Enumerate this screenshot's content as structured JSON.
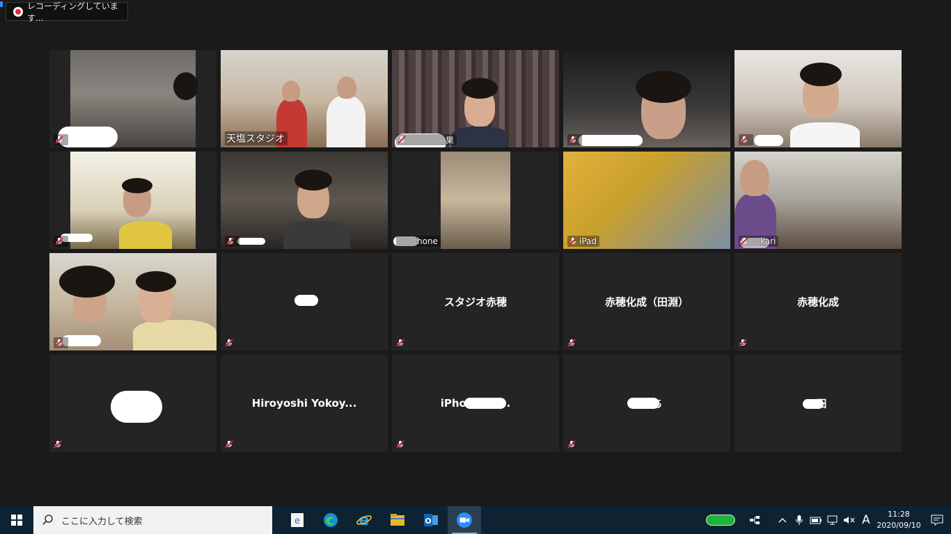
{
  "recording": {
    "label": "レコーディングしています..."
  },
  "tiles": [
    {
      "name": ""
    },
    {
      "name": "天塩スタジオ"
    },
    {
      "name": "果"
    },
    {
      "name": ""
    },
    {
      "name": ""
    },
    {
      "name": ""
    },
    {
      "name": ""
    },
    {
      "name": "hone"
    },
    {
      "name": "iPad"
    },
    {
      "name": "kari"
    },
    {
      "name": ""
    },
    {
      "name": ""
    },
    {
      "name": "スタジオ赤穂"
    },
    {
      "name": "赤穂化成（田淵）"
    },
    {
      "name": "赤穂化成"
    },
    {
      "name": ""
    },
    {
      "name": "Hiroyoshi  Yokoy..."
    },
    {
      "name": "iPhone…3..."
    },
    {
      "name": "ち"
    },
    {
      "name": "田"
    }
  ],
  "taskbar": {
    "search_placeholder": "ここに入力して検索",
    "apps": [
      "file-explorer-ie-icon",
      "edge-icon",
      "internet-explorer-icon",
      "folder-icon",
      "outlook-icon",
      "zoom-icon"
    ],
    "ime": "A",
    "time": "11:28",
    "date": "2020/09/10"
  },
  "colors": {
    "active_speaker": "#cfe26b",
    "taskbar": "#0f2231",
    "mute_red": "#d9263a"
  }
}
